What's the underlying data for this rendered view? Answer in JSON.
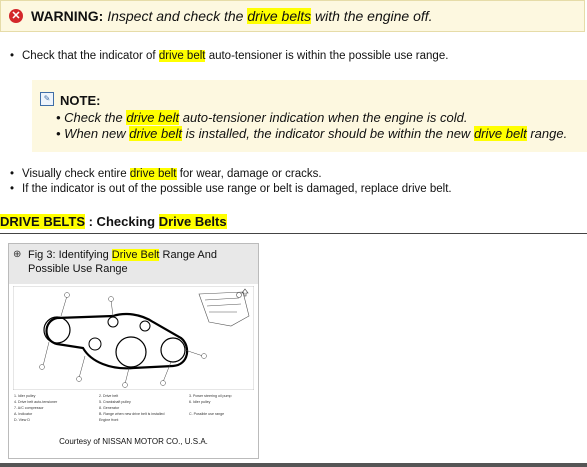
{
  "warning": {
    "label": "WARNING:",
    "text_pre": "Inspect and check the",
    "highlight": "drive belts",
    "text_post": "with the engine off."
  },
  "check": {
    "pre": "Check that the indicator of",
    "highlight": "drive belt",
    "post": "auto-tensioner is within the possible use range."
  },
  "note": {
    "title": "NOTE:",
    "line1_pre": "Check the",
    "line1_hl": "drive belt",
    "line1_post": "auto-tensioner indication when the engine is cold.",
    "line2_pre": "When new",
    "line2_hl1": "drive belt",
    "line2_mid": "is installed, the indicator should be within the new",
    "line2_hl2": "drive belt",
    "line2_post": "range."
  },
  "visual": {
    "pre": "Visually check entire",
    "highlight": "drive belt",
    "post": "for wear, damage or cracks."
  },
  "replace_text": "If the indicator is out of the possible use range or belt is damaged, replace drive belt.",
  "heading": {
    "hl1": "DRIVE BELTS",
    "mid": " : Checking ",
    "hl2": "Drive Belts"
  },
  "figure": {
    "title_pre": "Fig 3: Identifying",
    "title_hl": "Drive Belt",
    "title_post": "Range And Possible Use Range",
    "legend": [
      "1.  Idler pulley",
      "2.  Drive belt",
      "3.  Power steering oil pump",
      "4.  Drive belt auto-tensioner",
      "5.  Crankshaft pulley",
      "6.  Idler pulley",
      "7.  A/C compressor",
      "8.  Generator",
      "A.  Indicator",
      "B.  Range when new drive belt is installed",
      "C.  Possible use range",
      "D.  View D",
      "Engine front"
    ],
    "courtesy": "Courtesy of NISSAN MOTOR CO., U.S.A."
  }
}
